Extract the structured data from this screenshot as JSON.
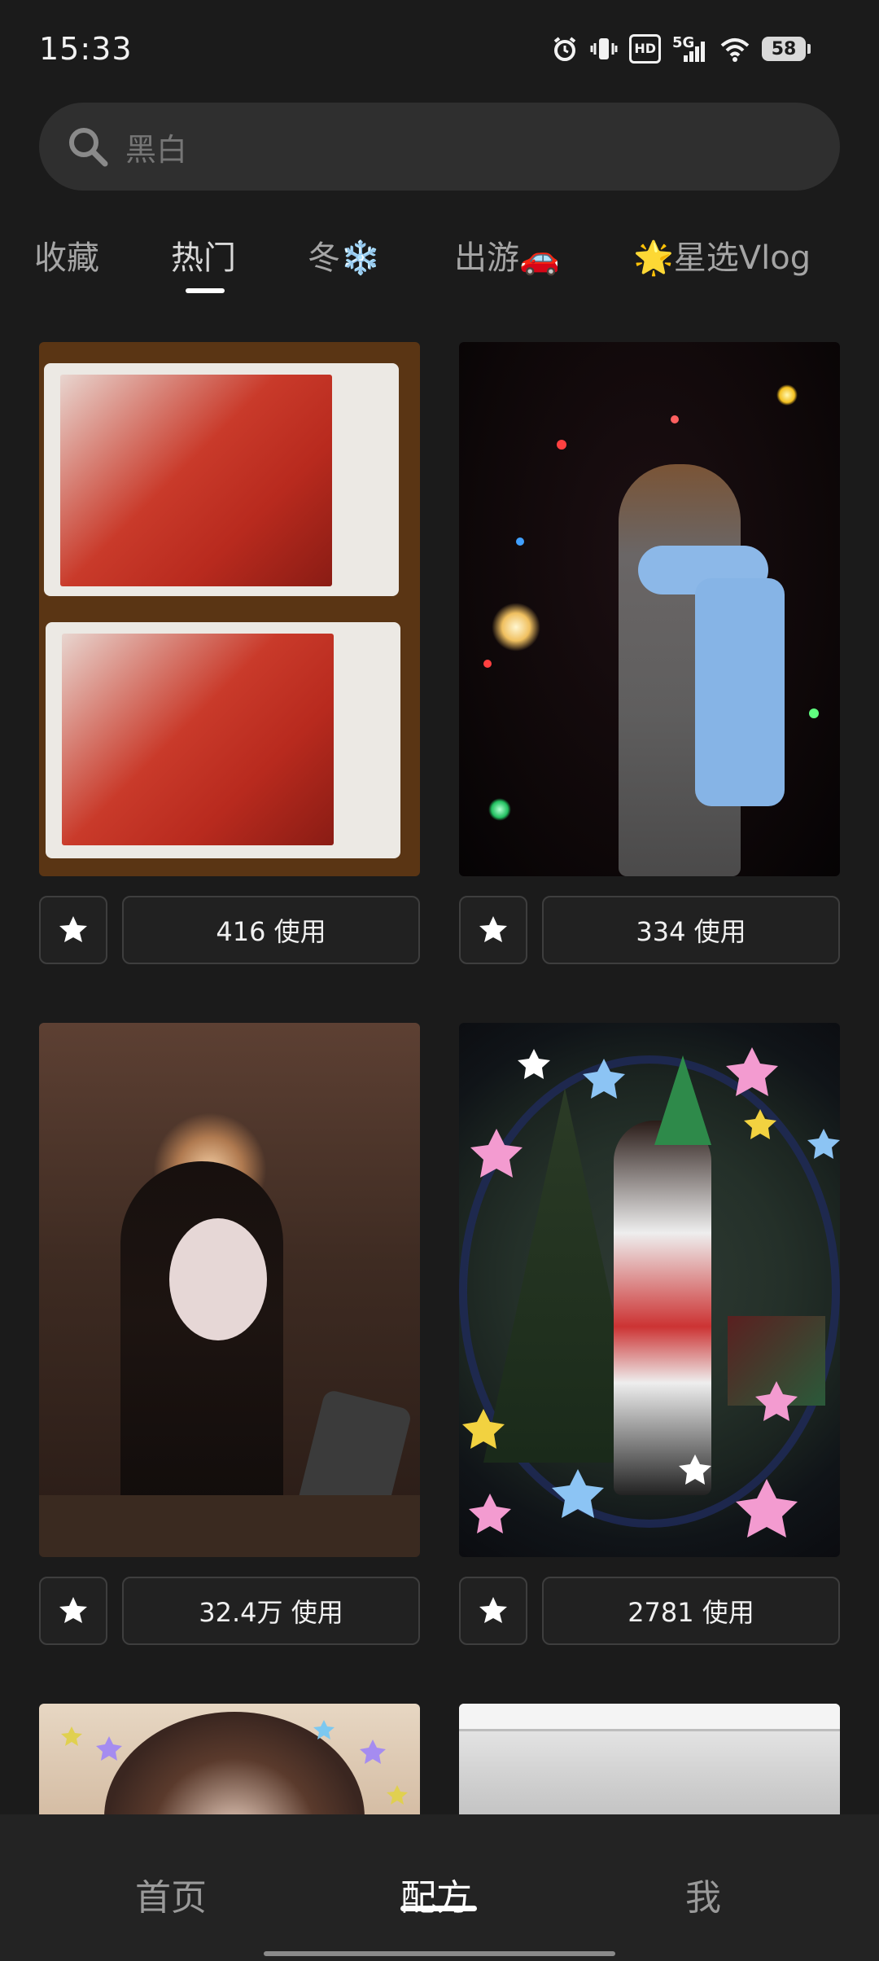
{
  "status_bar": {
    "time": "15:33",
    "icons": [
      "alarm-icon",
      "vibrate-icon",
      "hd-icon",
      "5g-signal-icon",
      "wifi-icon",
      "battery-icon"
    ],
    "hd_label": "HD",
    "network_label": "5G",
    "battery_level": "58"
  },
  "search": {
    "placeholder": "黑白"
  },
  "tabs": [
    {
      "label": "收藏",
      "active": false
    },
    {
      "label": "热门",
      "active": true
    },
    {
      "label": "冬❄️",
      "active": false
    },
    {
      "label": "出游🚗",
      "active": false
    },
    {
      "label": "🌟星选Vlog",
      "active": false
    }
  ],
  "cards": [
    {
      "usage_label": "416 使用",
      "favorite_icon": "star-icon",
      "image": "polaroid-collage"
    },
    {
      "usage_label": "334 使用",
      "favorite_icon": "star-icon",
      "image": "night-sparkler"
    },
    {
      "usage_label": "32.4万 使用",
      "favorite_icon": "star-icon",
      "image": "cafe-portrait"
    },
    {
      "usage_label": "2781 使用",
      "favorite_icon": "star-icon",
      "image": "christmas-tree"
    },
    {
      "image": "star-portrait"
    },
    {
      "image": "gray-room"
    }
  ],
  "bottom_nav": [
    {
      "label": "首页",
      "active": false
    },
    {
      "label": "配方",
      "active": true
    },
    {
      "label": "我",
      "active": false
    }
  ],
  "colors": {
    "background": "#1b1b1b",
    "search_bg": "#2f2f2f",
    "button_border": "#3e3e3e",
    "nav_bg": "#232323",
    "active": "#ffffff",
    "inactive": "#9a9a9a"
  }
}
